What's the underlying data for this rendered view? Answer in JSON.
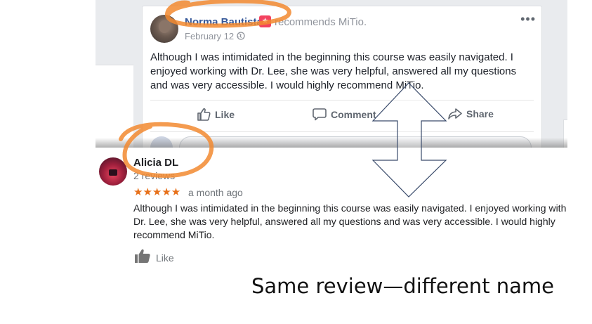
{
  "facebook_post": {
    "author": "Norma Bautista",
    "recommends_text": "recommends MiTio.",
    "date": "February 12 ·",
    "more_icon": "more-dots-icon",
    "text": "Although I was intimidated in the beginning this course was easily navigated. I enjoyed working with Dr. Lee, she was very helpful, answered all my questions and was very accessible. I would highly recommend MiTio.",
    "actions": {
      "like": "Like",
      "comment": "Comment",
      "share": "Share"
    }
  },
  "google_review": {
    "author": "Alicia DL",
    "review_count": "2 reviews",
    "stars": "★★★★★",
    "rating": 5,
    "time": "a month ago",
    "text": "Although I was intimidated in the beginning this course was easily navigated. I enjoyed working with Dr. Lee, she was very helpful, answered all my questions and was very accessible. I would highly recommend MiTio.",
    "like_label": "Like"
  },
  "caption": "Same review—different name",
  "colors": {
    "highlight": "#f28a30",
    "fb_link": "#365899",
    "google_star": "#e7711b"
  }
}
